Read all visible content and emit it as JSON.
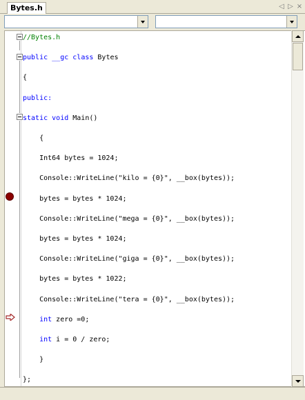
{
  "tab": {
    "label": "Bytes.h"
  },
  "tabnav": {
    "prev": "◁",
    "next": "▷",
    "close": "×"
  },
  "dropdowns": {
    "left_value": "",
    "right_value": ""
  },
  "code": {
    "lines": [
      {
        "text": "//Bytes.h",
        "kind": "comment"
      },
      {
        "text": "public __gc class Bytes",
        "kind": "keyword-line"
      },
      {
        "text": "{",
        "kind": "text"
      },
      {
        "text": "public:",
        "kind": "keyword"
      },
      {
        "text": "static void Main()",
        "kind": "keyword-line"
      },
      {
        "text": "    {",
        "kind": "text"
      },
      {
        "text": "    Int64 bytes = 1024;",
        "kind": "text"
      },
      {
        "text": "    Console::WriteLine(\"kilo = {0}\", __box(bytes));",
        "kind": "text"
      },
      {
        "text": "    bytes = bytes * 1024;",
        "kind": "text"
      },
      {
        "text": "    Console::WriteLine(\"mega = {0}\", __box(bytes));",
        "kind": "text"
      },
      {
        "text": "    bytes = bytes * 1024;",
        "kind": "text"
      },
      {
        "text": "    Console::WriteLine(\"giga = {0}\", __box(bytes));",
        "kind": "text"
      },
      {
        "text": "    bytes = bytes * 1022;",
        "kind": "text"
      },
      {
        "text": "    Console::WriteLine(\"tera = {0}\", __box(bytes));",
        "kind": "text"
      },
      {
        "text": "    int zero =0;",
        "kind": "text"
      },
      {
        "text": "    int i = 0 / zero;",
        "kind": "text"
      },
      {
        "text": "    }",
        "kind": "text"
      },
      {
        "text": "};",
        "kind": "text"
      }
    ]
  },
  "colors": {
    "comment": "#008000",
    "keyword": "#0000ff",
    "breakpoint": "#8b0000",
    "instruction_pointer": "#a52a2a"
  },
  "gutter": {
    "breakpoint_icon": "breakpoint-icon",
    "arrow_icon": "instruction-pointer-icon"
  }
}
